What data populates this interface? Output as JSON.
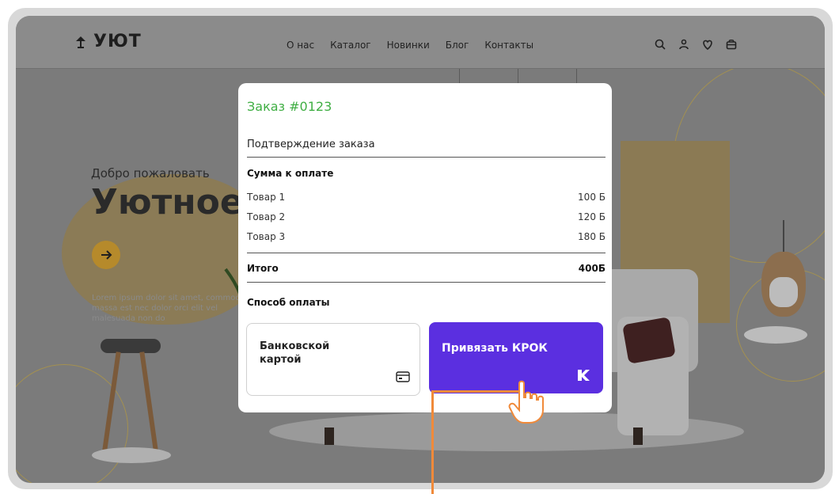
{
  "site": {
    "logo_text": "УЮТ",
    "nav": [
      "О нас",
      "Каталог",
      "Новинки",
      "Блог",
      "Контакты"
    ],
    "icons": [
      "search-icon",
      "user-icon",
      "heart-icon",
      "bag-icon"
    ]
  },
  "hero": {
    "welcome": "Добро пожаловать",
    "headline": "Уютное",
    "lorem": "Lorem ipsum dolor sit amet, commodo massa est nec dolor orci elit vel malesuada non do"
  },
  "modal": {
    "order_title": "Заказ #0123",
    "confirmation": "Подтверждение заказа",
    "sum_title": "Сумма к оплате",
    "items": [
      {
        "name": "Товар 1",
        "price": "100 Б"
      },
      {
        "name": "Товар 2",
        "price": "120 Б"
      },
      {
        "name": "Товар 3",
        "price": "180 Б"
      }
    ],
    "total_label": "Итого",
    "total_value": "400Б",
    "payment_title": "Способ оплаты",
    "card_label": "Банковской картой",
    "krok_label": "Привязать КРОК"
  },
  "colors": {
    "accent_green": "#3fae43",
    "krok_purple": "#5b2fe0",
    "highlight_orange": "#f08a3a"
  }
}
